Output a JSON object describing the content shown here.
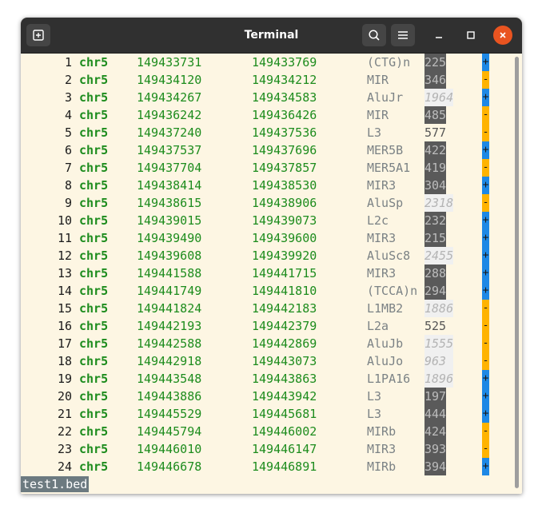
{
  "window": {
    "title": "Terminal"
  },
  "colors": {
    "plus_strand": "#1e88e5",
    "minus_strand": "#ffb300",
    "chrom": "#1d8c1d"
  },
  "rows": [
    {
      "n": "1",
      "chrom": "chr5",
      "start": "149433731",
      "end": "149433769",
      "name": "(CTG)n",
      "score": "225",
      "strand": "+"
    },
    {
      "n": "2",
      "chrom": "chr5",
      "start": "149434120",
      "end": "149434212",
      "name": "MIR",
      "score": "346",
      "strand": "-"
    },
    {
      "n": "3",
      "chrom": "chr5",
      "start": "149434267",
      "end": "149434583",
      "name": "AluJr",
      "score": "1964",
      "strand": "+"
    },
    {
      "n": "4",
      "chrom": "chr5",
      "start": "149436242",
      "end": "149436426",
      "name": "MIR",
      "score": "485",
      "strand": "-"
    },
    {
      "n": "5",
      "chrom": "chr5",
      "start": "149437240",
      "end": "149437536",
      "name": "L3",
      "score": "577",
      "strand": "-"
    },
    {
      "n": "6",
      "chrom": "chr5",
      "start": "149437537",
      "end": "149437696",
      "name": "MER5B",
      "score": "422",
      "strand": "+"
    },
    {
      "n": "7",
      "chrom": "chr5",
      "start": "149437704",
      "end": "149437857",
      "name": "MER5A1",
      "score": "419",
      "strand": "-"
    },
    {
      "n": "8",
      "chrom": "chr5",
      "start": "149438414",
      "end": "149438530",
      "name": "MIR3",
      "score": "304",
      "strand": "+"
    },
    {
      "n": "9",
      "chrom": "chr5",
      "start": "149438615",
      "end": "149438906",
      "name": "AluSp",
      "score": "2318",
      "strand": "-"
    },
    {
      "n": "10",
      "chrom": "chr5",
      "start": "149439015",
      "end": "149439073",
      "name": "L2c",
      "score": "232",
      "strand": "+"
    },
    {
      "n": "11",
      "chrom": "chr5",
      "start": "149439490",
      "end": "149439600",
      "name": "MIR3",
      "score": "215",
      "strand": "+"
    },
    {
      "n": "12",
      "chrom": "chr5",
      "start": "149439608",
      "end": "149439920",
      "name": "AluSc8",
      "score": "2455",
      "strand": "+"
    },
    {
      "n": "13",
      "chrom": "chr5",
      "start": "149441588",
      "end": "149441715",
      "name": "MIR3",
      "score": "288",
      "strand": "+"
    },
    {
      "n": "14",
      "chrom": "chr5",
      "start": "149441749",
      "end": "149441810",
      "name": "(TCCA)n",
      "score": "294",
      "strand": "+"
    },
    {
      "n": "15",
      "chrom": "chr5",
      "start": "149441824",
      "end": "149442183",
      "name": "L1MB2",
      "score": "1886",
      "strand": "-"
    },
    {
      "n": "16",
      "chrom": "chr5",
      "start": "149442193",
      "end": "149442379",
      "name": "L2a",
      "score": "525",
      "strand": "-"
    },
    {
      "n": "17",
      "chrom": "chr5",
      "start": "149442588",
      "end": "149442869",
      "name": "AluJb",
      "score": "1555",
      "strand": "-"
    },
    {
      "n": "18",
      "chrom": "chr5",
      "start": "149442918",
      "end": "149443073",
      "name": "AluJo",
      "score": "963",
      "strand": "-"
    },
    {
      "n": "19",
      "chrom": "chr5",
      "start": "149443548",
      "end": "149443863",
      "name": "L1PA16",
      "score": "1896",
      "strand": "+"
    },
    {
      "n": "20",
      "chrom": "chr5",
      "start": "149443886",
      "end": "149443942",
      "name": "L3",
      "score": "197",
      "strand": "+"
    },
    {
      "n": "21",
      "chrom": "chr5",
      "start": "149445529",
      "end": "149445681",
      "name": "L3",
      "score": "444",
      "strand": "+"
    },
    {
      "n": "22",
      "chrom": "chr5",
      "start": "149445794",
      "end": "149446002",
      "name": "MIRb",
      "score": "424",
      "strand": "-"
    },
    {
      "n": "23",
      "chrom": "chr5",
      "start": "149446010",
      "end": "149446147",
      "name": "MIR3",
      "score": "393",
      "strand": "-"
    },
    {
      "n": "24",
      "chrom": "chr5",
      "start": "149446678",
      "end": "149446891",
      "name": "MIRb",
      "score": "394",
      "strand": "+"
    }
  ],
  "status": {
    "filename": "test1.bed"
  }
}
